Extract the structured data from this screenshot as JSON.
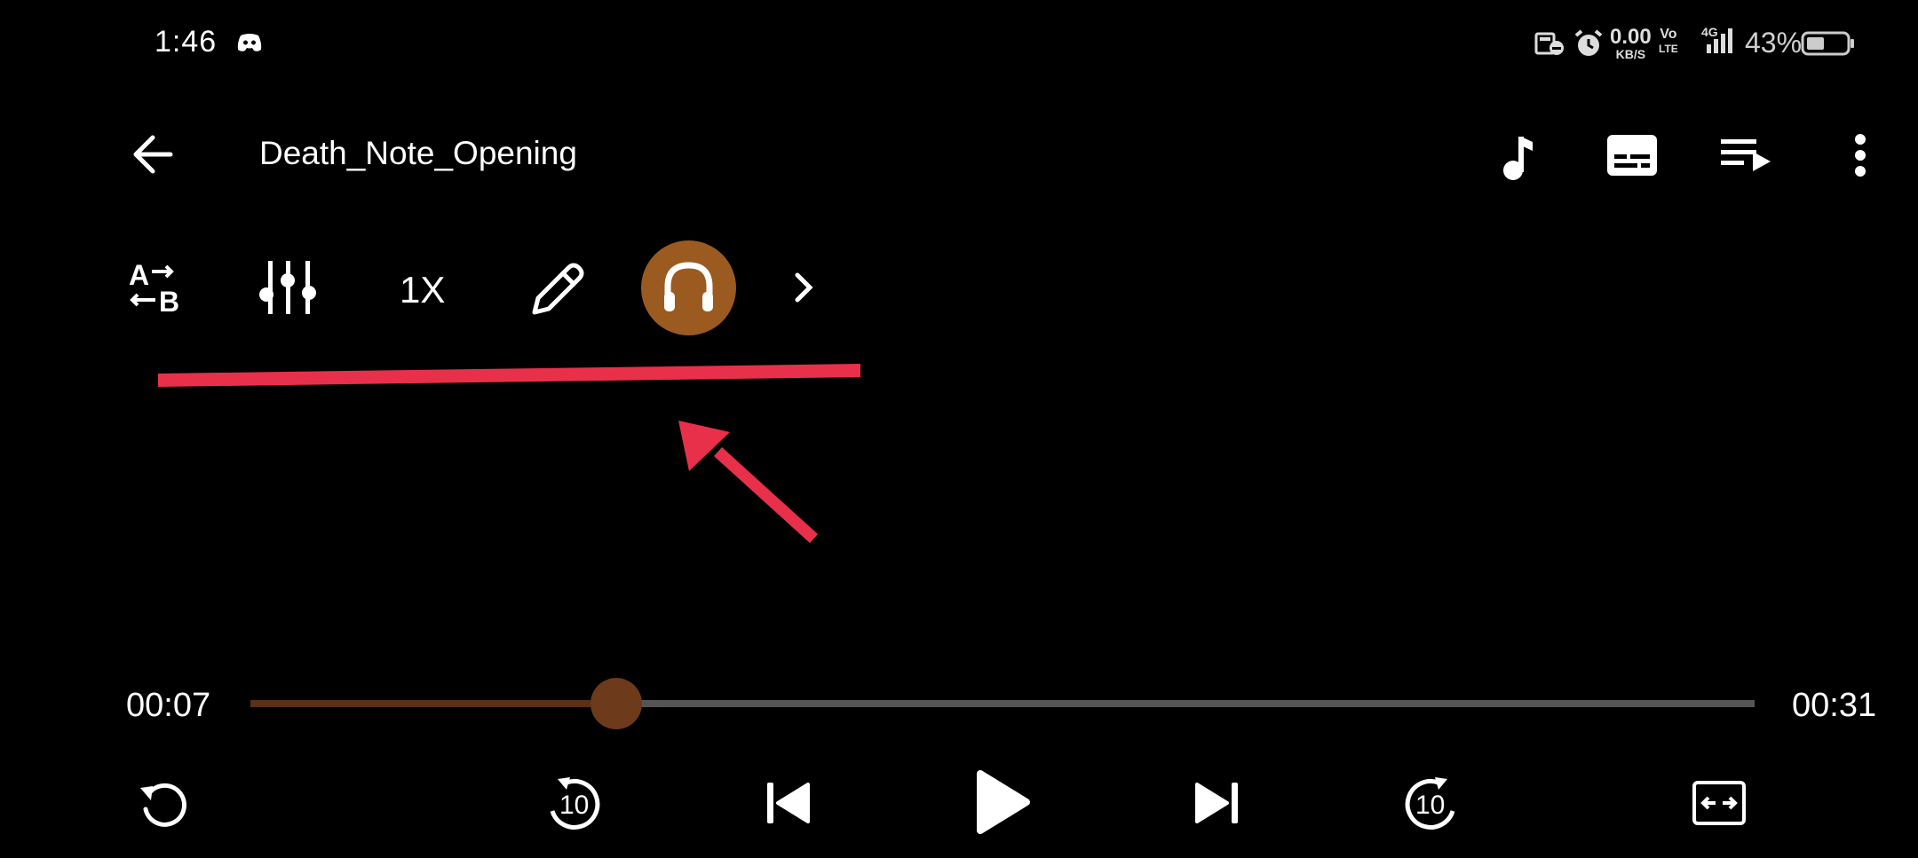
{
  "status_bar": {
    "time": "1:46",
    "net_speed_value": "0.00",
    "net_speed_unit": "KB/S",
    "volte_top": "Vo",
    "volte_bottom": "LTE",
    "network_type": "4G",
    "battery_percent": "43%",
    "battery_level": 0.43
  },
  "header": {
    "title": "Death_Note_Opening",
    "icons": [
      "back-arrow-icon",
      "music-note-icon",
      "subtitles-icon",
      "playlist-icon",
      "more-vert-icon"
    ]
  },
  "toolbar": {
    "ab_top": "A",
    "ab_bottom": "B",
    "speed_label": "1X",
    "icons": [
      "ab-repeat-icon",
      "equalizer-icon",
      "edit-icon",
      "headphone-icon",
      "chevron-right-icon"
    ],
    "headphone_active": true
  },
  "annotation": {
    "color": "#e8304a"
  },
  "playback": {
    "current_time": "00:07",
    "total_time": "00:31",
    "progress": 0.243,
    "rewind_label": "10",
    "forward_label": "10"
  },
  "colors": {
    "accent": "#9a5a20",
    "seek_played": "#5c3017",
    "seek_thumb": "#6e3a1c",
    "seek_track": "#555555",
    "background": "#000000"
  }
}
